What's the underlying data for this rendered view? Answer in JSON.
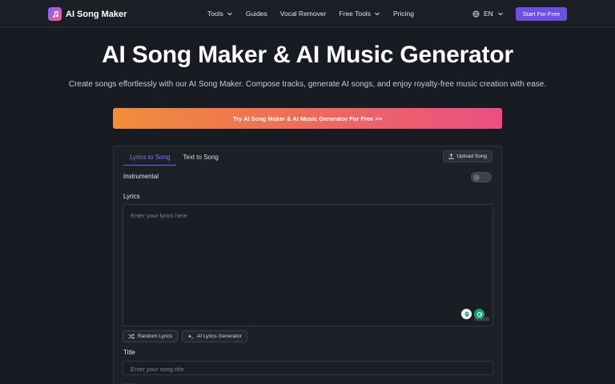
{
  "header": {
    "brand": "AI Song Maker",
    "nav": [
      {
        "label": "Tools",
        "has_dropdown": true
      },
      {
        "label": "Guides",
        "has_dropdown": false
      },
      {
        "label": "Vocal Remover",
        "has_dropdown": false
      },
      {
        "label": "Free Tools",
        "has_dropdown": true
      },
      {
        "label": "Pricing",
        "has_dropdown": false
      }
    ],
    "language": "EN",
    "cta_label": "Start For Free"
  },
  "hero": {
    "title": "AI Song Maker & AI Music Generator",
    "subtitle": "Create songs effortlessly with our AI Song Maker. Compose tracks, generate AI songs, and enjoy royalty-free music creation with ease.",
    "try_label": "Try AI Song Maker & AI Music Generator For Free >>"
  },
  "panel": {
    "tabs": [
      {
        "label": "Lyrics to Song",
        "active": true
      },
      {
        "label": "Text to Song",
        "active": false
      }
    ],
    "upload_label": "Upload Song",
    "instrumental_label": "Instrumental",
    "instrumental_on": false,
    "lyrics_label": "Lyrics",
    "lyrics_placeholder": "Enter your lyrics here",
    "lyrics_counter": "0/3000",
    "random_lyrics_label": "Random Lyrics",
    "ai_lyrics_label": "AI Lyrics Generator",
    "title_label": "Title",
    "title_placeholder": "Enter your song title"
  },
  "colors": {
    "accent": "#6d4fe6",
    "background": "#181b21",
    "gradient_start": "#f08e3a",
    "gradient_end": "#ea4f84"
  },
  "icons": [
    "music-note-icon",
    "chevron-down-icon",
    "globe-icon",
    "upload-icon",
    "shuffle-icon",
    "sparkle-icon",
    "location-pin-icon",
    "grammar-check-icon"
  ]
}
